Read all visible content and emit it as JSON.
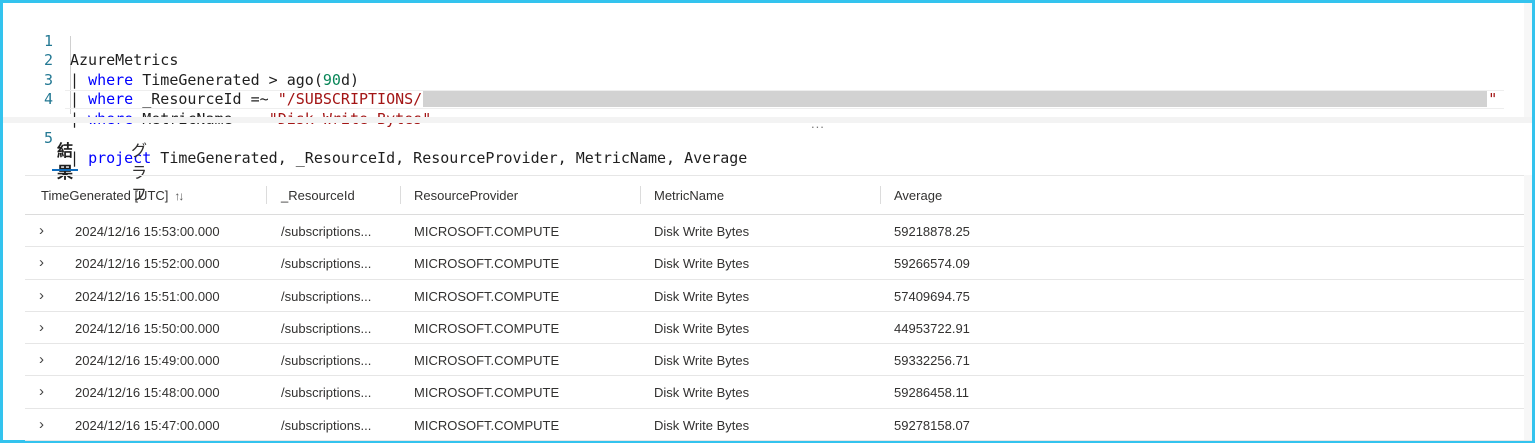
{
  "editor": {
    "lines": [
      {
        "n": "1",
        "plain": "AzureMetrics"
      },
      {
        "n": "2",
        "pipe": "| ",
        "kw": "where",
        "rest_a": " TimeGenerated > ago(",
        "num": "90",
        "rest_b": "d)"
      },
      {
        "n": "3",
        "pipe": "| ",
        "kw": "where",
        "rest_a": " _ResourceId =~ ",
        "str_a": "\"/SUBSCRIPTIONS/",
        "str_b": "\""
      },
      {
        "n": "4",
        "pipe": "| ",
        "kw": "where",
        "rest_a": " MetricName =~ ",
        "str_a": "\"Disk Write Bytes\""
      },
      {
        "n": "5",
        "pipe": "| ",
        "kw": "project",
        "rest_a": " TimeGenerated, _ResourceId, ResourceProvider, MetricName, Average"
      }
    ],
    "splitter": "..."
  },
  "tabs": [
    {
      "label": "結果",
      "active": true
    },
    {
      "label": "グラフ",
      "active": false
    }
  ],
  "table": {
    "columns": [
      "TimeGenerated [UTC]",
      "_ResourceId",
      "ResourceProvider",
      "MetricName",
      "Average"
    ],
    "sort_icon": "↑↓",
    "expander_icon": "›",
    "rows": [
      [
        "2024/12/16 15:53:00.000",
        "/subscriptions...",
        "MICROSOFT.COMPUTE",
        "Disk Write Bytes",
        "59218878.25"
      ],
      [
        "2024/12/16 15:52:00.000",
        "/subscriptions...",
        "MICROSOFT.COMPUTE",
        "Disk Write Bytes",
        "59266574.09"
      ],
      [
        "2024/12/16 15:51:00.000",
        "/subscriptions...",
        "MICROSOFT.COMPUTE",
        "Disk Write Bytes",
        "57409694.75"
      ],
      [
        "2024/12/16 15:50:00.000",
        "/subscriptions...",
        "MICROSOFT.COMPUTE",
        "Disk Write Bytes",
        "44953722.91"
      ],
      [
        "2024/12/16 15:49:00.000",
        "/subscriptions...",
        "MICROSOFT.COMPUTE",
        "Disk Write Bytes",
        "59332256.71"
      ],
      [
        "2024/12/16 15:48:00.000",
        "/subscriptions...",
        "MICROSOFT.COMPUTE",
        "Disk Write Bytes",
        "59286458.11"
      ],
      [
        "2024/12/16 15:47:00.000",
        "/subscriptions...",
        "MICROSOFT.COMPUTE",
        "Disk Write Bytes",
        "59278158.07"
      ]
    ]
  },
  "colors": {
    "frame": "#33c3ee",
    "keyword": "#0000ff",
    "string": "#a31515",
    "number": "#098658",
    "line_number": "#237893",
    "tab_underline": "#0f6cbd"
  }
}
